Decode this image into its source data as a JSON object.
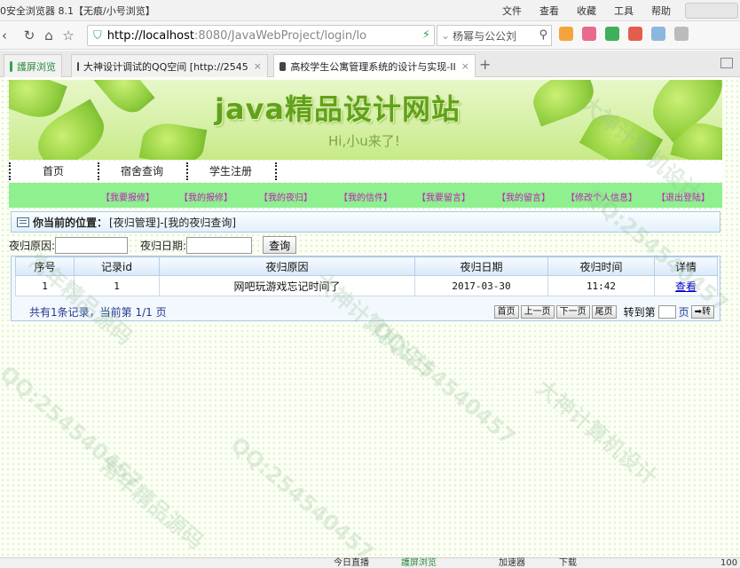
{
  "browser": {
    "title": "0安全浏览器 8.1【无痕/小号浏览】",
    "menu": [
      "文件",
      "查看",
      "收藏",
      "工具",
      "帮助"
    ],
    "url_host": "http://localhost",
    "url_rest": ":8080/JavaWebProject/login/lo",
    "search_text": "杨幂与公公刘",
    "tabs": [
      {
        "label": "護屏浏览"
      },
      {
        "label": "大神设计调试的QQ空间 [http://2545",
        "close": "×"
      },
      {
        "label": "高校学生公寓管理系统的设计与实现-II",
        "close": "×"
      }
    ],
    "new_tab": "+"
  },
  "banner": {
    "title": "java精品设计网站",
    "subtitle": "Hi,小u来了!"
  },
  "menu": {
    "items": [
      "首页",
      "宿舍查询",
      "学生注册"
    ]
  },
  "submenu": {
    "items": [
      "【我要报修】",
      "【我的报修】",
      "【我的夜归】",
      "【我的信件】",
      "【我要留言】",
      "【我的留言】",
      "【修改个人信息】",
      "【退出登陆】"
    ]
  },
  "location": {
    "label": "你当前的位置：",
    "path": "[夜归管理]-[我的夜归查询]"
  },
  "search": {
    "reason_label": "夜归原因:",
    "date_label": "夜归日期:",
    "button": "查询"
  },
  "table": {
    "headers": [
      "序号",
      "记录id",
      "夜归原因",
      "夜归日期",
      "夜归时间",
      "详情"
    ],
    "rows": [
      [
        "1",
        "1",
        "网吧玩游戏忘记时间了",
        "2017-03-30",
        "11:42",
        "查看"
      ]
    ]
  },
  "pager": {
    "info": "共有1条记录，当前第 1/1 页",
    "first": "首页",
    "prev": "上一页",
    "next": "下一页",
    "last": "尾页",
    "goto_label": "转到第",
    "page_unit": "页",
    "go": "➡转"
  },
  "watermarks": [
    "大神计算机设计",
    "QQ:254540457",
    "常年精品源码",
    "大神计算机设计",
    "QQ:254540457",
    "QQ:254540457",
    "大神计算机设计",
    "常年精品源码",
    "QQ:254540457"
  ],
  "statusbar": [
    "今日直播",
    "護屏浏览",
    "加速器",
    "下载",
    "100"
  ]
}
